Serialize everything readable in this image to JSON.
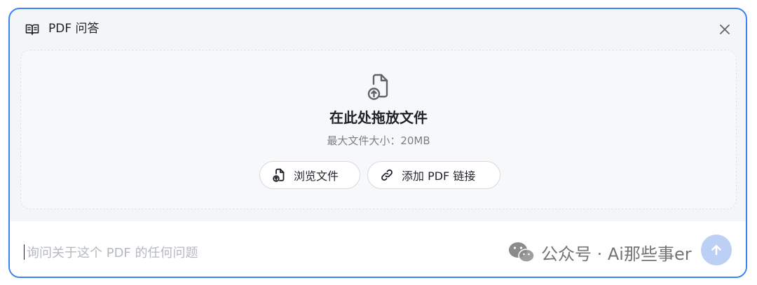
{
  "header": {
    "title": "PDF 问答",
    "icons": {
      "title_icon": "book-open-icon",
      "close_icon": "close-icon"
    }
  },
  "dropzone": {
    "icon": "file-upload-icon",
    "title": "在此处拖放文件",
    "subtitle": "最大文件大小：20MB",
    "buttons": {
      "browse": {
        "label": "浏览文件",
        "icon": "file-upload-icon"
      },
      "add_link": {
        "label": "添加 PDF 链接",
        "icon": "link-icon"
      }
    }
  },
  "composer": {
    "placeholder": "询问关于这个 PDF 的任何问题",
    "value": "",
    "send_icon": "arrow-up-icon"
  },
  "watermark": {
    "text": "公众号 · Ai那些事er",
    "icon": "wechat-icon"
  },
  "colors": {
    "accent_border": "#3b82f6",
    "send_button": "#bcd0f6",
    "panel_bg": "#f4f5f7"
  }
}
